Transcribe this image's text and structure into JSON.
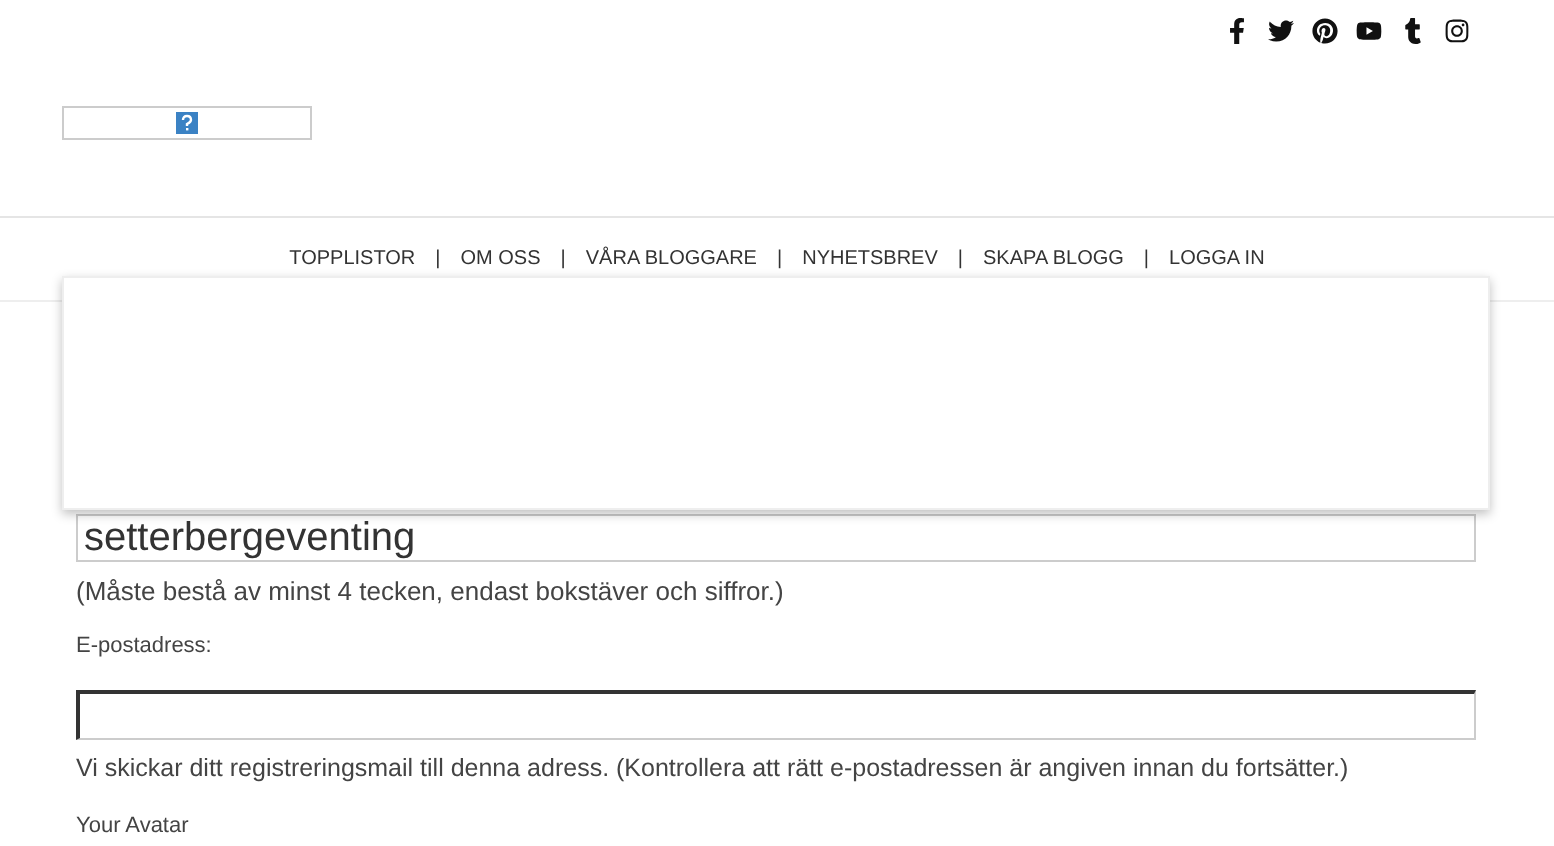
{
  "social_icons": [
    {
      "kind": "facebook"
    },
    {
      "kind": "twitter"
    },
    {
      "kind": "pinterest"
    },
    {
      "kind": "youtube"
    },
    {
      "kind": "tumblr"
    },
    {
      "kind": "instagram"
    }
  ],
  "nav": [
    {
      "label": "TOPPLISTOR"
    },
    {
      "label": "OM OSS"
    },
    {
      "label": "VÅRA BLOGGARE"
    },
    {
      "label": "NYHETSBREV"
    },
    {
      "label": "SKAPA BLOGG"
    },
    {
      "label": "LOGGA IN"
    }
  ],
  "nav_separator": "|",
  "form": {
    "username_value": "setterbergeventing",
    "username_hint": "(Måste bestå av minst 4 tecken, endast bokstäver och siffror.)",
    "email_label": "E-postadress:",
    "email_hint": "Vi skickar ditt registreringsmail till denna adress. (Kontrollera att rätt e-postadressen är angiven innan du fortsätter.)",
    "avatar_label": "Your Avatar"
  }
}
